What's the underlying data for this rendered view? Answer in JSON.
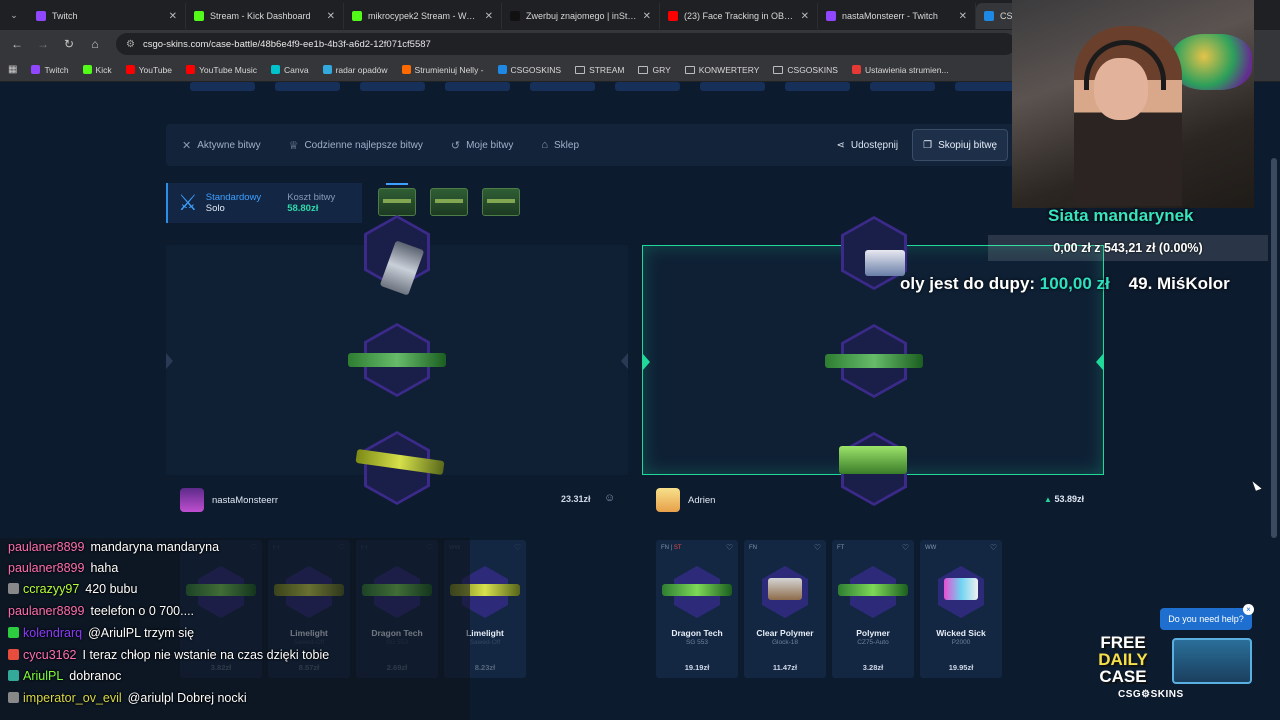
{
  "browser": {
    "tabs": [
      {
        "title": "Twitch",
        "color": "#9146ff"
      },
      {
        "title": "Stream - Kick Dashboard",
        "color": "#53fc18"
      },
      {
        "title": "mikrocypek2 Stream - Watch Li",
        "color": "#53fc18"
      },
      {
        "title": "Zwerbuj znajomego | inStream",
        "color": "#111111"
      },
      {
        "title": "(23) Face Tracking in OBS | Com",
        "color": "#ff0000"
      },
      {
        "title": "nastaMonsteerr - Twitch",
        "color": "#9146ff"
      },
      {
        "title": "CSG",
        "color": "#1e88e5"
      }
    ],
    "url": "csgo-skins.com/case-battle/48b6e4f9-ee1b-4b3f-a6d2-12f071cf5587",
    "bookmarks": [
      {
        "label": "Twitch",
        "color": "#9146ff"
      },
      {
        "label": "Kick",
        "color": "#53fc18"
      },
      {
        "label": "YouTube",
        "color": "#ff0000"
      },
      {
        "label": "YouTube Music",
        "color": "#ff0000"
      },
      {
        "label": "Canva",
        "color": "#00c4cc"
      },
      {
        "label": "radar opadów",
        "color": "#33aadd"
      },
      {
        "label": "Strumieniuj Nelly -",
        "color": "#ff6a00"
      },
      {
        "label": "CSGOSKINS",
        "color": "#1e88e5"
      },
      {
        "label": "STREAM",
        "folder": true
      },
      {
        "label": "GRY",
        "folder": true
      },
      {
        "label": "KONWERTERY",
        "folder": true
      },
      {
        "label": "CSGOSKINS",
        "folder": true
      },
      {
        "label": "Ustawienia strumien...",
        "color": "#e53935"
      }
    ]
  },
  "nav": {
    "active_battles": "Aktywne bitwy",
    "daily_best": "Codzienne najlepsze bitwy",
    "my_battles": "Moje bitwy",
    "shop": "Sklep",
    "share": "Udostępnij",
    "copy_battle": "Skopiuj bitwę"
  },
  "battle": {
    "mode_label": "Standardowy",
    "mode_value": "Solo",
    "cost_label": "Koszt bitwy",
    "cost_value": "58.80zł"
  },
  "players": {
    "left": {
      "name": "nastaMonsteerr",
      "total": "23.31zł"
    },
    "right": {
      "name": "Adrien",
      "total": "53.89zł"
    }
  },
  "left_items": [
    {
      "name": "",
      "sub": "",
      "price": "3.82zł",
      "wear": ""
    },
    {
      "name": "Limelight",
      "sub": "Sawed-Off",
      "price": "8.57zł",
      "wear": "FT"
    },
    {
      "name": "Dragon Tech",
      "sub": "SG 553",
      "price": "2.69zł",
      "wear": "FT"
    },
    {
      "name": "Limelight",
      "sub": "Sawed-Off",
      "price": "8.23zł",
      "wear": "WW"
    }
  ],
  "right_items": [
    {
      "name": "Dragon Tech",
      "sub": "SG 553",
      "price": "19.19zł",
      "wear": "FN",
      "st": "ST"
    },
    {
      "name": "Clear Polymer",
      "sub": "Glock-18",
      "price": "11.47zł",
      "wear": "FN"
    },
    {
      "name": "Polymer",
      "sub": "CZ75-Auto",
      "price": "3.28zł",
      "wear": "FT"
    },
    {
      "name": "Wicked Sick",
      "sub": "P2000",
      "price": "19.95zł",
      "wear": "WW"
    }
  ],
  "overlay": {
    "goal_title": "Siata mandarynek",
    "goal_amount": "0,00 zł z 543,21 zł (0.00%)",
    "ticker_a": "oly jest do dupy:",
    "ticker_b": "100,00 zł",
    "ticker_c": "49. MiśKolor"
  },
  "chat": [
    {
      "user": "paulaner8899",
      "text": "mandaryna mandaryna",
      "color": "#ff6fb1"
    },
    {
      "user": "paulaner8899",
      "text": "haha",
      "color": "#ff6fb1"
    },
    {
      "user": "ccrazyy97",
      "text": "420 bubu",
      "color": "#b6ff3a"
    },
    {
      "user": "paulaner8899",
      "text": "teelefon o 0 700....",
      "color": "#ff6fb1"
    },
    {
      "user": "kolendrarq",
      "text": "@AriulPL trzym się",
      "color": "#8a3cff"
    },
    {
      "user": "cycu3162",
      "text": "I teraz chłop nie wstanie na czas dzięki tobie",
      "color": "#ff6fb1"
    },
    {
      "user": "AriulPL",
      "text": "dobranoc",
      "color": "#7dff3a"
    },
    {
      "user": "imperator_ov_evil",
      "text": "@ariulpl Dobrej nocki",
      "color": "#d8d846"
    }
  ],
  "promo": {
    "free": "FREE",
    "daily": "DAILY",
    "case": "CASE",
    "brand": "CSG⚙SKINS",
    "help": "Do you need help?"
  }
}
